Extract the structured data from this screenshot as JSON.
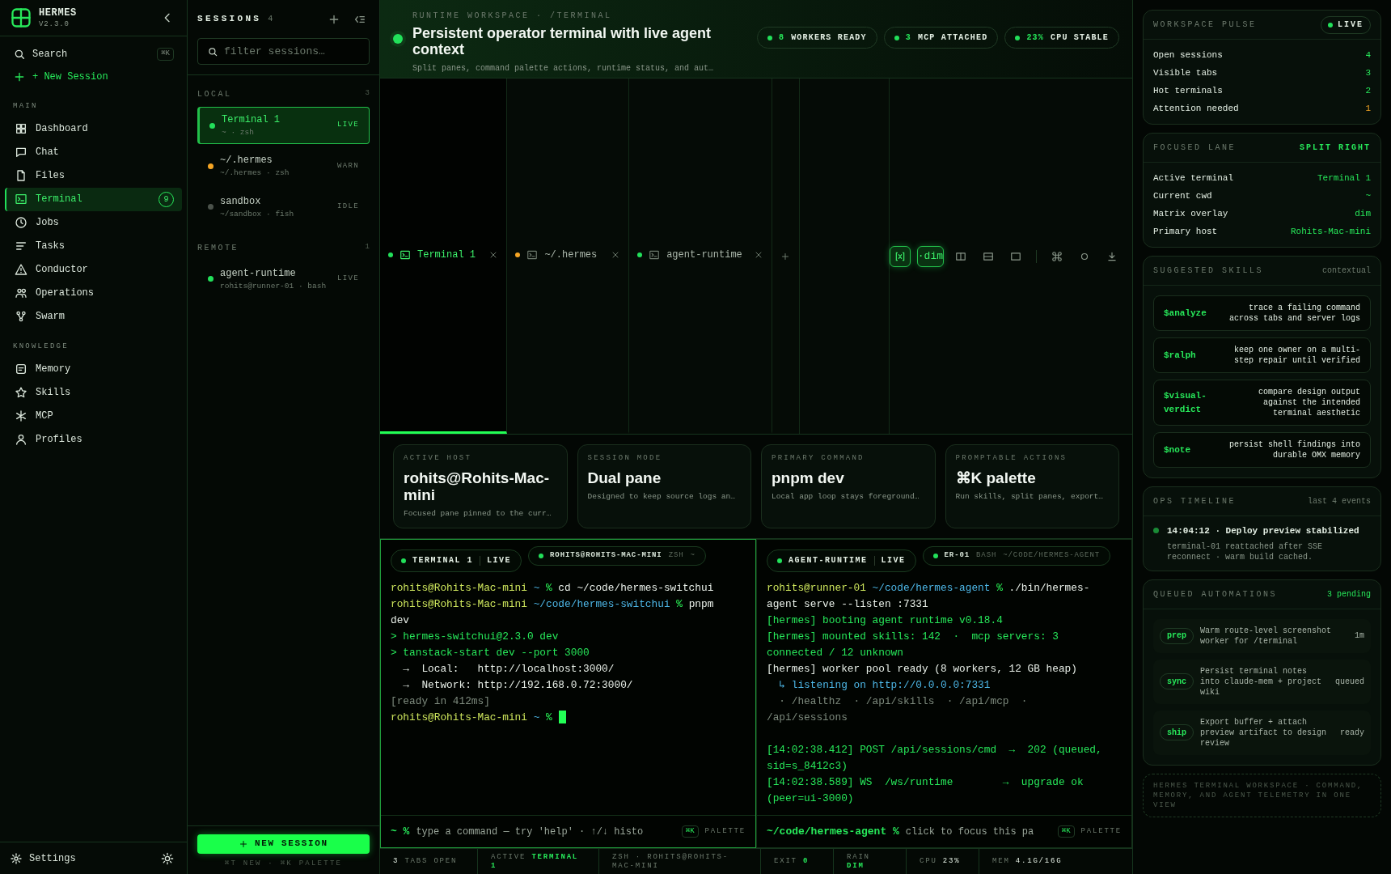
{
  "sidebar": {
    "brand": "HERMES",
    "version": "V2.3.0",
    "search": {
      "label": "Search",
      "shortcut": "⌘K"
    },
    "new_session": "+ New Session",
    "sections": [
      {
        "title": "MAIN",
        "items": [
          {
            "label": "Dashboard",
            "kind": "grid",
            "selected": false
          },
          {
            "label": "Chat",
            "kind": "chat",
            "selected": false
          },
          {
            "label": "Files",
            "kind": "file",
            "selected": false
          },
          {
            "label": "Terminal",
            "kind": "terminal",
            "selected": true,
            "badge": "9"
          },
          {
            "label": "Jobs",
            "kind": "clock",
            "selected": false
          },
          {
            "label": "Tasks",
            "kind": "list",
            "selected": false
          },
          {
            "label": "Conductor",
            "kind": "warning",
            "selected": false
          },
          {
            "label": "Operations",
            "kind": "users",
            "selected": false
          },
          {
            "label": "Swarm",
            "kind": "branch",
            "selected": false
          }
        ]
      },
      {
        "title": "KNOWLEDGE",
        "items": [
          {
            "label": "Memory",
            "kind": "note",
            "selected": false
          },
          {
            "label": "Skills",
            "kind": "star",
            "selected": false
          },
          {
            "label": "MCP",
            "kind": "asterisk",
            "selected": false
          },
          {
            "label": "Profiles",
            "kind": "person",
            "selected": false
          }
        ]
      }
    ],
    "settings": "Settings"
  },
  "sessions": {
    "title": "SESSIONS",
    "count": "4",
    "search": {
      "placeholder": "filter sessions…"
    },
    "groups": [
      {
        "title": "LOCAL",
        "count": "3",
        "items": [
          {
            "name": "Terminal 1",
            "detail": "~ · zsh",
            "status": "LIVE",
            "color": "#22e05a",
            "selected": true
          },
          {
            "name": "~/.hermes",
            "detail": "~/.hermes · zsh",
            "status": "WARN",
            "color": "#f5a524",
            "selected": false
          },
          {
            "name": "sandbox",
            "detail": "~/sandbox · fish",
            "status": "IDLE",
            "color": "#4b524b",
            "selected": false
          }
        ]
      },
      {
        "title": "REMOTE",
        "count": "1",
        "items": [
          {
            "name": "agent-runtime",
            "detail": "rohits@runner-01 · bash",
            "status": "LIVE",
            "color": "#22e05a",
            "selected": false
          }
        ]
      }
    ],
    "new_session": "NEW SESSION",
    "hint": "⌘T NEW · ⌘K PALETTE"
  },
  "header": {
    "eyebrow": "RUNTIME WORKSPACE · /TERMINAL",
    "title": "Persistent operator terminal with live agent context",
    "subtitle": "Split panes, command palette actions, runtime status, and aut…",
    "pills": [
      {
        "value": "8",
        "label": "WORKERS READY"
      },
      {
        "value": "3",
        "label": "MCP ATTACHED"
      },
      {
        "value": "23%",
        "label": "CPU STABLE"
      }
    ]
  },
  "tabs": [
    {
      "label": "Terminal 1",
      "color": "#22e05a",
      "selected": true
    },
    {
      "label": "~/.hermes",
      "color": "#f5a524",
      "selected": false
    },
    {
      "label": "agent-runtime",
      "color": "#22e05a",
      "selected": false
    }
  ],
  "toolbar": [
    {
      "kind": "matrix",
      "active": true
    },
    {
      "kind": "text",
      "label": "·dim",
      "active": true
    },
    {
      "kind": "split-columns",
      "active": false
    },
    {
      "kind": "split-rows",
      "active": false
    },
    {
      "kind": "single",
      "active": false
    },
    {
      "kind": "command",
      "active": false
    },
    {
      "kind": "circle",
      "active": false
    },
    {
      "kind": "download",
      "active": false
    }
  ],
  "cards": [
    {
      "label": "ACTIVE HOST",
      "value": "rohits@Rohits-Mac-mini",
      "note": "Focused pane pinned to the curr…"
    },
    {
      "label": "SESSION MODE",
      "value": "Dual pane",
      "note": "Designed to keep source logs an…"
    },
    {
      "label": "PRIMARY COMMAND",
      "value": "pnpm dev",
      "note": "Local app loop stays foreground…"
    },
    {
      "label": "PROMPTABLE ACTIONS",
      "value": "⌘K palette",
      "note": "Run skills, split panes, export…"
    }
  ],
  "panes": [
    {
      "focused": true,
      "title": "TERMINAL 1",
      "state": "LIVE",
      "host": "ROHITS@ROHITS-MAC-MINI",
      "shell": "ZSH",
      "cwd": "~",
      "prompt": "~ %",
      "placeholder": "type a command — try 'help' · ↑/↓ histo",
      "shortcut": "⌘K",
      "shortcut_label": "PALETTE",
      "lines": [
        {
          "segments": [
            {
              "text": "rohits@Rohits-Mac-mini",
              "kind": "prompt"
            },
            {
              "text": " ~",
              "kind": "path"
            },
            {
              "text": " %",
              "kind": "sym"
            },
            {
              "text": " cd ~/code/hermes-switchui",
              "kind": "cmd"
            }
          ]
        },
        {
          "segments": [
            {
              "text": "rohits@Rohits-Mac-mini",
              "kind": "prompt"
            },
            {
              "text": " ~/code/hermes-switchui",
              "kind": "path"
            },
            {
              "text": " %",
              "kind": "sym"
            },
            {
              "text": " pnpm dev",
              "kind": "cmd"
            }
          ]
        },
        {
          "segments": [
            {
              "text": "> hermes-switchui@2.3.0 dev",
              "kind": "ok"
            }
          ]
        },
        {
          "segments": [
            {
              "text": "> tanstack-start dev --port 3000",
              "kind": "ok"
            }
          ]
        },
        {
          "segments": [
            {
              "text": "  →  Local:   http://localhost:3000/",
              "kind": "cmd"
            }
          ]
        },
        {
          "segments": [
            {
              "text": "  →  Network: http://192.168.0.72:3000/",
              "kind": "cmd"
            }
          ]
        },
        {
          "segments": [
            {
              "text": "[ready in 412ms]",
              "kind": "dim"
            }
          ]
        },
        {
          "segments": [
            {
              "text": "rohits@Rohits-Mac-mini",
              "kind": "prompt"
            },
            {
              "text": " ~",
              "kind": "path"
            },
            {
              "text": " %",
              "kind": "sym"
            }
          ],
          "cursor": true
        }
      ]
    },
    {
      "focused": false,
      "title": "AGENT-RUNTIME",
      "state": "LIVE",
      "host": "ER-01",
      "shell": "BASH",
      "cwd": "~/CODE/HERMES-AGENT",
      "prompt": "~/code/hermes-agent %",
      "placeholder": "click to focus this pa",
      "shortcut": "⌘K",
      "shortcut_label": "PALETTE",
      "lines": [
        {
          "segments": [
            {
              "text": "rohits@runner-01",
              "kind": "prompt"
            },
            {
              "text": " ~/code/hermes-agent",
              "kind": "path"
            },
            {
              "text": " %",
              "kind": "sym"
            },
            {
              "text": " ./bin/hermes-agent serve --listen :7331",
              "kind": "cmd"
            }
          ]
        },
        {
          "segments": [
            {
              "text": "[hermes] booting agent runtime v0.18.4",
              "kind": "ok"
            }
          ]
        },
        {
          "segments": [
            {
              "text": "[hermes] mounted skills: 142  ·  mcp servers: 3 connected / 12 unknown",
              "kind": "ok"
            }
          ]
        },
        {
          "segments": [
            {
              "text": "[hermes] worker pool ready (8 workers, 12 GB heap)",
              "kind": "cmd"
            }
          ]
        },
        {
          "segments": [
            {
              "text": "  ↳ listening on http://0.0.0.0:7331",
              "kind": "link"
            }
          ]
        },
        {
          "segments": [
            {
              "text": "  · /healthz  · /api/skills  · /api/mcp  · /api/sessions",
              "kind": "dim"
            }
          ]
        },
        {
          "spaced": true,
          "segments": [
            {
              "text": "[14:02:38.412] POST /api/sessions/cmd  →  202 (queued, sid=s_8412c3)",
              "kind": "ok"
            }
          ]
        },
        {
          "segments": [
            {
              "text": "[14:02:38.589] WS  /ws/runtime        →  upgrade ok (peer=ui-3000)",
              "kind": "ok"
            }
          ]
        }
      ]
    }
  ],
  "status_bar": [
    {
      "parts": [
        {
          "text": "3",
          "kind": "value"
        },
        {
          "text": "TABS OPEN",
          "kind": "label"
        }
      ]
    },
    {
      "parts": [
        {
          "text": "ACTIVE",
          "kind": "label"
        },
        {
          "text": "TERMINAL 1",
          "kind": "accent"
        }
      ]
    },
    {
      "parts": [
        {
          "text": "ZSH · ROHITS@ROHITS-MAC-MINI",
          "kind": "label"
        }
      ]
    },
    {
      "parts": [
        {
          "text": "EXIT",
          "kind": "label"
        },
        {
          "text": "0",
          "kind": "accent"
        }
      ]
    },
    {
      "parts": [
        {
          "text": "RAIN",
          "kind": "label"
        },
        {
          "text": "DIM",
          "kind": "accent"
        }
      ]
    },
    {
      "parts": [
        {
          "text": "CPU",
          "kind": "label"
        },
        {
          "text": "23%",
          "kind": "value"
        }
      ]
    },
    {
      "parts": [
        {
          "text": "MEM",
          "kind": "label"
        },
        {
          "text": "4.1G/16G",
          "kind": "value"
        }
      ]
    }
  ],
  "pulse": {
    "title": "WORKSPACE PULSE",
    "badge": "LIVE",
    "rows": [
      {
        "label": "Open sessions",
        "value": "4",
        "kind": "normal"
      },
      {
        "label": "Visible tabs",
        "value": "3",
        "kind": "normal"
      },
      {
        "label": "Hot terminals",
        "value": "2",
        "kind": "normal"
      },
      {
        "label": "Attention needed",
        "value": "1",
        "kind": "warning"
      }
    ]
  },
  "focused_lane": {
    "title": "FOCUSED LANE",
    "mode": "SPLIT RIGHT",
    "rows": [
      {
        "label": "Active terminal",
        "value": "Terminal 1"
      },
      {
        "label": "Current cwd",
        "value": "~"
      },
      {
        "label": "Matrix overlay",
        "value": "dim"
      },
      {
        "label": "Primary host",
        "value": "Rohits-Mac-mini"
      }
    ]
  },
  "skills": {
    "title": "SUGGESTED SKILLS",
    "note": "contextual",
    "items": [
      {
        "command": "$analyze",
        "description": "trace a failing command across tabs and server logs"
      },
      {
        "command": "$ralph",
        "description": "keep one owner on a multi-step repair until verified"
      },
      {
        "command": "$visual-verdict",
        "description": "compare design output against the intended terminal aesthetic"
      },
      {
        "command": "$note",
        "description": "persist shell findings into durable OMX memory"
      }
    ]
  },
  "timeline": {
    "title": "OPS TIMELINE",
    "note": "last 4 events",
    "events": [
      {
        "title": "14:04:12 · Deploy preview stabilized",
        "detail": "terminal-01 reattached after SSE reconnect · warm build cached."
      }
    ]
  },
  "automations": {
    "title": "QUEUED AUTOMATIONS",
    "note": "3 pending",
    "items": [
      {
        "tag": "prep",
        "text": "Warm route-level screenshot worker for /terminal",
        "status": "1m"
      },
      {
        "tag": "sync",
        "text": "Persist terminal notes into claude-mem + project wiki",
        "status": "queued"
      },
      {
        "tag": "ship",
        "text": "Export buffer + attach preview artifact to design review",
        "status": "ready"
      }
    ]
  },
  "footer_note": "HERMES TERMINAL WORKSPACE · COMMAND, MEMORY, AND AGENT TELEMETRY IN ONE VIEW"
}
